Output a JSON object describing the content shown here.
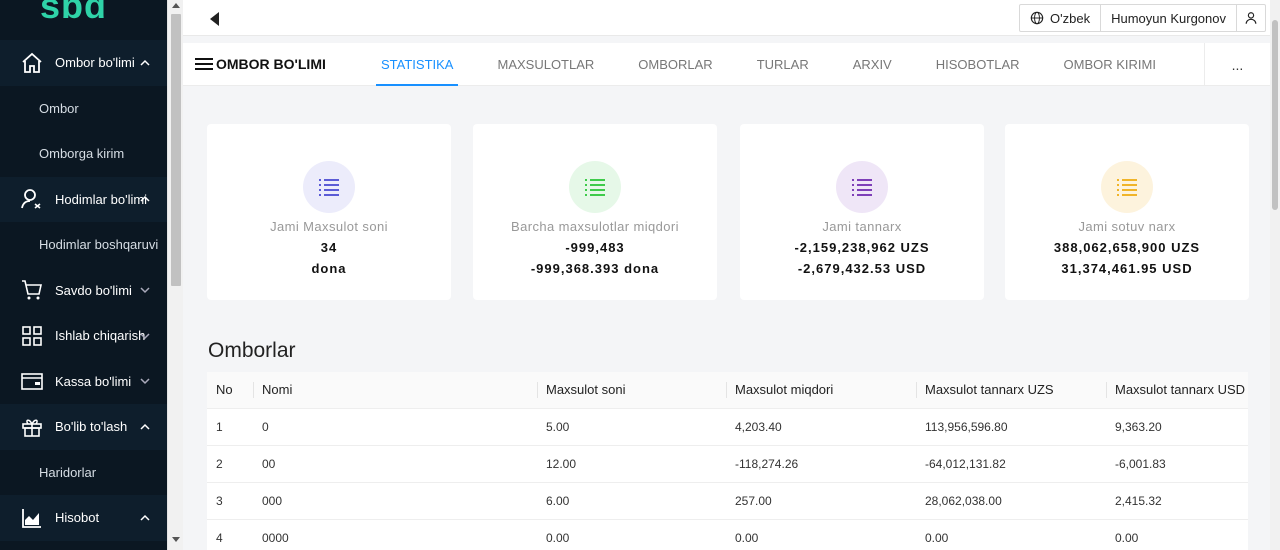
{
  "logo": {
    "text": "sbd"
  },
  "sidebar": {
    "items": [
      {
        "label": "Ombor bo'limi",
        "type": "parent",
        "icon": "home-icon",
        "caret": "up"
      },
      {
        "label": "Ombor",
        "type": "sub"
      },
      {
        "label": "Omborga kirim",
        "type": "sub"
      },
      {
        "label": "Hodimlar bo'limi",
        "type": "parent",
        "icon": "user-icon",
        "caret": "up"
      },
      {
        "label": "Hodimlar boshqaruvi",
        "type": "sub"
      },
      {
        "label": "Savdo bo'limi",
        "type": "parent",
        "icon": "cart-icon",
        "caret": "down"
      },
      {
        "label": "Ishlab chiqarish",
        "type": "parent",
        "icon": "grid-icon",
        "caret": "down"
      },
      {
        "label": "Kassa bo'limi",
        "type": "parent",
        "icon": "wallet-icon",
        "caret": "down"
      },
      {
        "label": "Bo'lib to'lash",
        "type": "parent",
        "icon": "gift-icon",
        "caret": "up"
      },
      {
        "label": "Haridorlar",
        "type": "sub"
      },
      {
        "label": "Hisobot",
        "type": "parent",
        "icon": "chart-icon",
        "caret": "up"
      }
    ]
  },
  "topbar": {
    "language": "O'zbek",
    "user_name": "Humoyun Kurgonov"
  },
  "section": {
    "title": "OMBOR BO'LIMI",
    "tabs": [
      "STATISTIKA",
      "MAXSULOTLAR",
      "OMBORLAR",
      "TURLAR",
      "ARXIV",
      "HISOBOTLAR",
      "OMBOR KIRIMI"
    ],
    "active_tab": "STATISTIKA",
    "more": "..."
  },
  "stats": [
    {
      "label": "Jami Maxsulot soni",
      "value": "34",
      "value2": "dona",
      "color": "#5b5bd6",
      "bg": "#ececfb"
    },
    {
      "label": "Barcha maxsulotlar miqdori",
      "value": "-999,483",
      "value2": "-999,368.393 dona",
      "color": "#3ecb4a",
      "bg": "#e6f8e8"
    },
    {
      "label": "Jami tannarx",
      "value": "-2,159,238,962 UZS",
      "value2": "-2,679,432.53 USD",
      "color": "#7e3fb8",
      "bg": "#efe6f7"
    },
    {
      "label": "Jami sotuv narx",
      "value": "388,062,658,900 UZS",
      "value2": "31,374,461.95 USD",
      "color": "#f0b429",
      "bg": "#fdf3dd"
    }
  ],
  "table": {
    "title": "Omborlar",
    "columns": [
      "No",
      "Nomi",
      "Maxsulot soni",
      "Maxsulot miqdori",
      "Maxsulot tannarx UZS",
      "Maxsulot tannarx USD"
    ],
    "rows": [
      {
        "no": "1",
        "name": "0",
        "count": "5.00",
        "qty": "4,203.40",
        "uzs": "113,956,596.80",
        "usd": "9,363.20",
        "qty_sign": "pos",
        "uzs_sign": "pos",
        "usd_sign": "pos"
      },
      {
        "no": "2",
        "name": "00",
        "count": "12.00",
        "qty": "-118,274.26",
        "uzs": "-64,012,131.82",
        "usd": "-6,001.83",
        "qty_sign": "neg",
        "uzs_sign": "neg",
        "usd_sign": "neg"
      },
      {
        "no": "3",
        "name": "000",
        "count": "6.00",
        "qty": "257.00",
        "uzs": "28,062,038.00",
        "usd": "2,415.32",
        "qty_sign": "pos",
        "uzs_sign": "pos",
        "usd_sign": "pos"
      },
      {
        "no": "4",
        "name": "0000",
        "count": "0.00",
        "qty": "0.00",
        "uzs": "0.00",
        "usd": "0.00",
        "qty_sign": "neg",
        "uzs_sign": "neg",
        "usd_sign": "neg"
      }
    ]
  }
}
